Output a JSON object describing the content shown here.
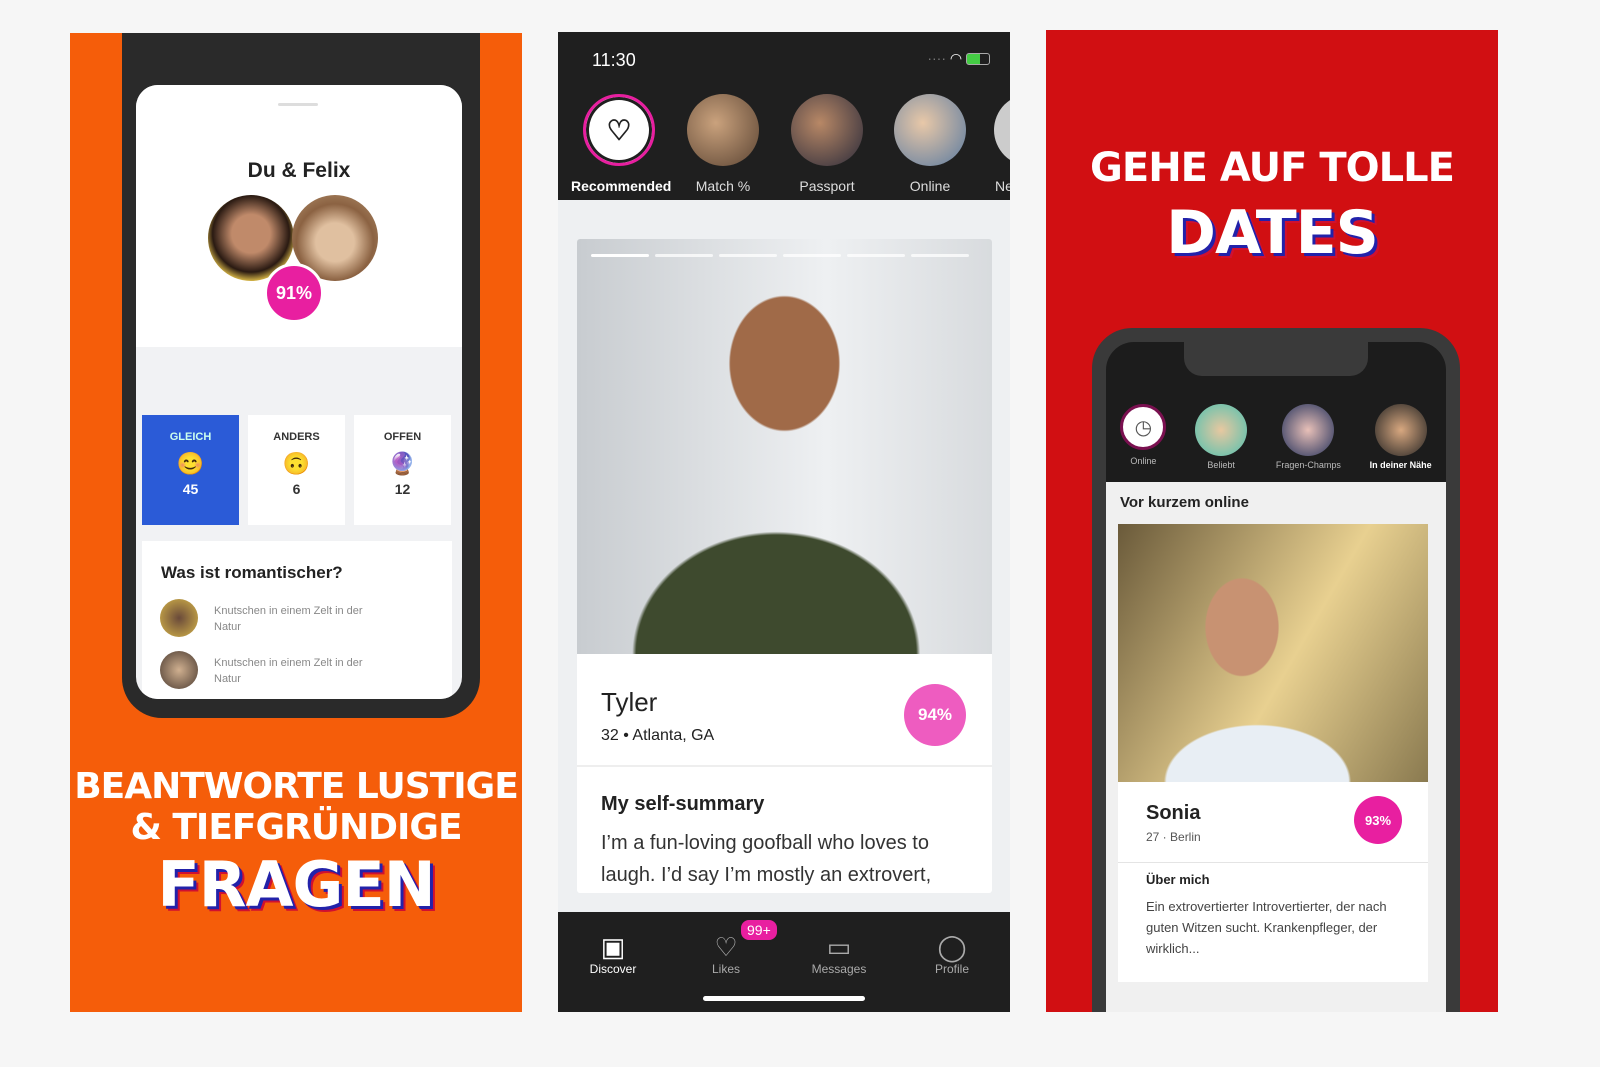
{
  "panel1": {
    "title": "Du & Felix",
    "match": "91%",
    "stats": [
      {
        "label": "GLEICH",
        "emoji": "😊",
        "count": "45"
      },
      {
        "label": "ANDERS",
        "emoji": "🙃",
        "count": "6"
      },
      {
        "label": "OFFEN",
        "emoji": "🔮",
        "count": "12"
      }
    ],
    "question": "Was ist romantischer?",
    "answers": [
      "Knutschen in einem Zelt in der Natur",
      "Knutschen in einem Zelt in der Natur"
    ],
    "headline1": "BEANTWORTE LUSTIGE",
    "headline2": "& TIEFGRÜNDIGE",
    "headline3": "FRAGEN",
    "colors": {
      "background": "#f55d0a",
      "selected": "#2b5bd7",
      "match": "#e81fa0"
    }
  },
  "panel2": {
    "time": "11:30",
    "stories": [
      {
        "label": "Recommended",
        "icon": "heart-sparkle-icon"
      },
      {
        "label": "Match %"
      },
      {
        "label": "Passport"
      },
      {
        "label": "Online"
      },
      {
        "label": "Ne"
      }
    ],
    "profile": {
      "name": "Tyler",
      "age": "32",
      "location": "Atlanta, GA",
      "match": "94%",
      "section_title": "My self-summary",
      "summary": "I’m a fun-loving goofball who loves to laugh. I’d say I’m mostly an extrovert,"
    },
    "nav": [
      {
        "label": "Discover",
        "icon": "discover-icon"
      },
      {
        "label": "Likes",
        "icon": "heart-icon",
        "badge": "99+"
      },
      {
        "label": "Messages",
        "icon": "message-icon"
      },
      {
        "label": "Profile",
        "icon": "profile-icon"
      }
    ],
    "colors": {
      "match": "#ee5cc0",
      "dark": "#1f1f1f"
    }
  },
  "panel3": {
    "headline1": "GEHE AUF TOLLE",
    "headline2": "DATES",
    "stories": [
      "Online",
      "Beliebt",
      "Fragen-Champs",
      "In deiner Nähe"
    ],
    "section": "Vor kurzem online",
    "profile": {
      "name": "Sonia",
      "meta": "27 · Berlin",
      "match": "93%",
      "about_title": "Über mich",
      "about": "Ein extrovertierter Introvertierter, der nach guten Witzen sucht. Krankenpfleger, der wirklich..."
    },
    "colors": {
      "background": "#d10f12",
      "match": "#e81fa0"
    }
  }
}
